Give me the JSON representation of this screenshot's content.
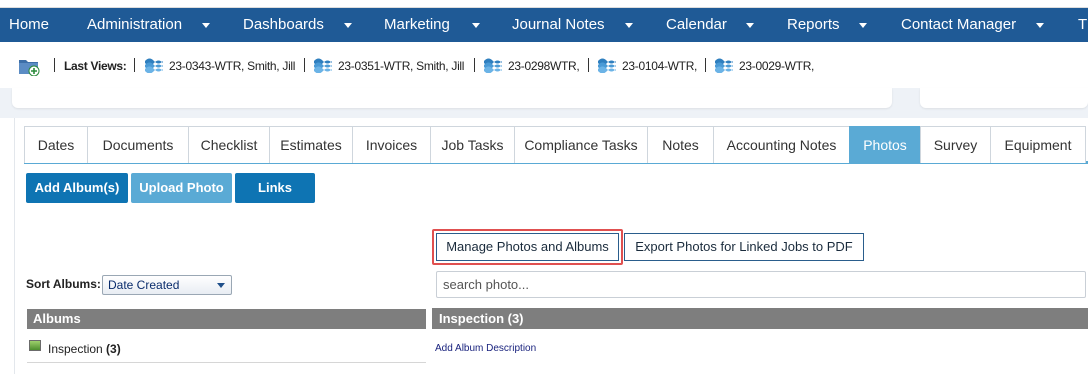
{
  "nav": {
    "items": [
      {
        "label": "Home",
        "caret": false
      },
      {
        "label": "Administration",
        "caret": true
      },
      {
        "label": "Dashboards",
        "caret": true
      },
      {
        "label": "Marketing",
        "caret": true
      },
      {
        "label": "Journal Notes",
        "caret": true
      },
      {
        "label": "Calendar",
        "caret": true
      },
      {
        "label": "Reports",
        "caret": true
      },
      {
        "label": "Contact Manager",
        "caret": true
      },
      {
        "label": "T",
        "caret": false
      }
    ],
    "bg_color": "#1f5a96"
  },
  "last_views": {
    "label": "Last Views:",
    "items": [
      "23-0343-WTR, Smith, Jill",
      "23-0351-WTR, Smith, Jill",
      "23-0298WTR,",
      "23-0104-WTR,",
      "23-0029-WTR,"
    ],
    "item_icon": "water-wave-icon",
    "folder_icon": "add-folder-icon"
  },
  "tabs": {
    "items": [
      "Dates",
      "Documents",
      "Checklist",
      "Estimates",
      "Invoices",
      "Job Tasks",
      "Compliance Tasks",
      "Notes",
      "Accounting Notes",
      "Photos",
      "Survey",
      "Equipment"
    ],
    "active": "Photos",
    "accent_color": "#5aaad5"
  },
  "actions": {
    "add_album": "Add Album(s)",
    "upload_photo": "Upload Photo",
    "links": "Links"
  },
  "photo_tools": {
    "manage": "Manage Photos and Albums",
    "export": "Export Photos for Linked Jobs to PDF",
    "highlight_color": "#e05050"
  },
  "sort": {
    "label": "Sort Albums:",
    "selected": "Date Created"
  },
  "search": {
    "placeholder": "search photo..."
  },
  "albums": {
    "header": "Albums",
    "list": [
      {
        "name": "Inspection",
        "count": "(3)"
      }
    ]
  },
  "album_detail": {
    "header": "Inspection (3)",
    "add_description": "Add Album Description"
  }
}
